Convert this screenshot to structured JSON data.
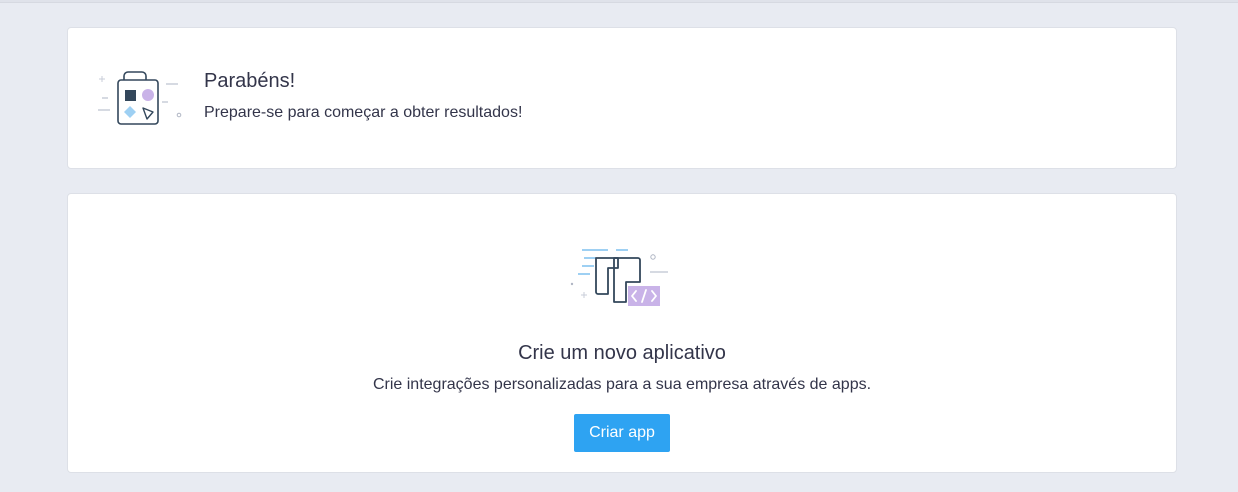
{
  "welcome": {
    "title": "Parabéns!",
    "subtitle": "Prepare-se para começar a obter resultados!",
    "illustration": "shopping-bag-icon"
  },
  "create_app": {
    "title": "Crie um novo aplicativo",
    "subtitle": "Crie integrações personalizadas para a sua empresa através de apps.",
    "button_label": "Criar app",
    "illustration": "app-code-icon"
  },
  "colors": {
    "background": "#e8ebf2",
    "card": "#ffffff",
    "primary_button": "#2ea3f2",
    "illustration_navy": "#33475b",
    "illustration_purple": "#c9b3e8",
    "illustration_lightblue": "#9ed0f3"
  }
}
